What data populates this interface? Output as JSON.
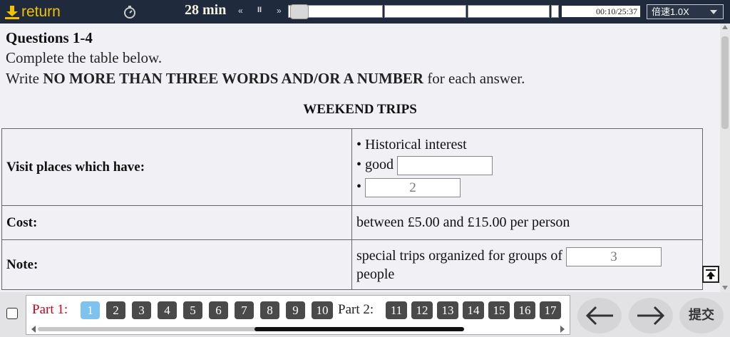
{
  "topbar": {
    "return_label": "return",
    "minutes": "28 min",
    "rewind": "«",
    "pause": "II",
    "forward": "»",
    "time": "00:10/25:37",
    "speed": "倍速1.0X"
  },
  "content": {
    "q_title": "Questions 1-4",
    "instr1": "Complete the table below.",
    "instr2_prefix": "Write ",
    "instr2_bold": "NO MORE THAN THREE WORDS AND/OR A NUMBER",
    "instr2_suffix": " for each answer.",
    "table_title": "WEEKEND TRIPS",
    "rows": [
      {
        "label": "Visit places which have:",
        "lines": [
          "• Historical interest",
          "• good",
          "•"
        ],
        "answers": [
          "",
          "2"
        ]
      },
      {
        "label": "Cost:",
        "value": "between £5.00 and £15.00 per person"
      },
      {
        "label": "Note:",
        "value_pre": "special trips organized for groups of",
        "answer": "3",
        "value_post": "people"
      }
    ]
  },
  "bottom": {
    "part1_label": "Part 1:",
    "part2_label": "Part 2:",
    "part1_numbers": [
      "1",
      "2",
      "3",
      "4",
      "5",
      "6",
      "7",
      "8",
      "9",
      "10"
    ],
    "part2_numbers": [
      "11",
      "12",
      "13",
      "14",
      "15",
      "16",
      "17"
    ],
    "submit_label": "提交"
  },
  "colors": {
    "accent": "#f2c200",
    "topbar": "#1f2a3c",
    "active_num": "#7ec3ef",
    "part_label": "#d0021b"
  }
}
